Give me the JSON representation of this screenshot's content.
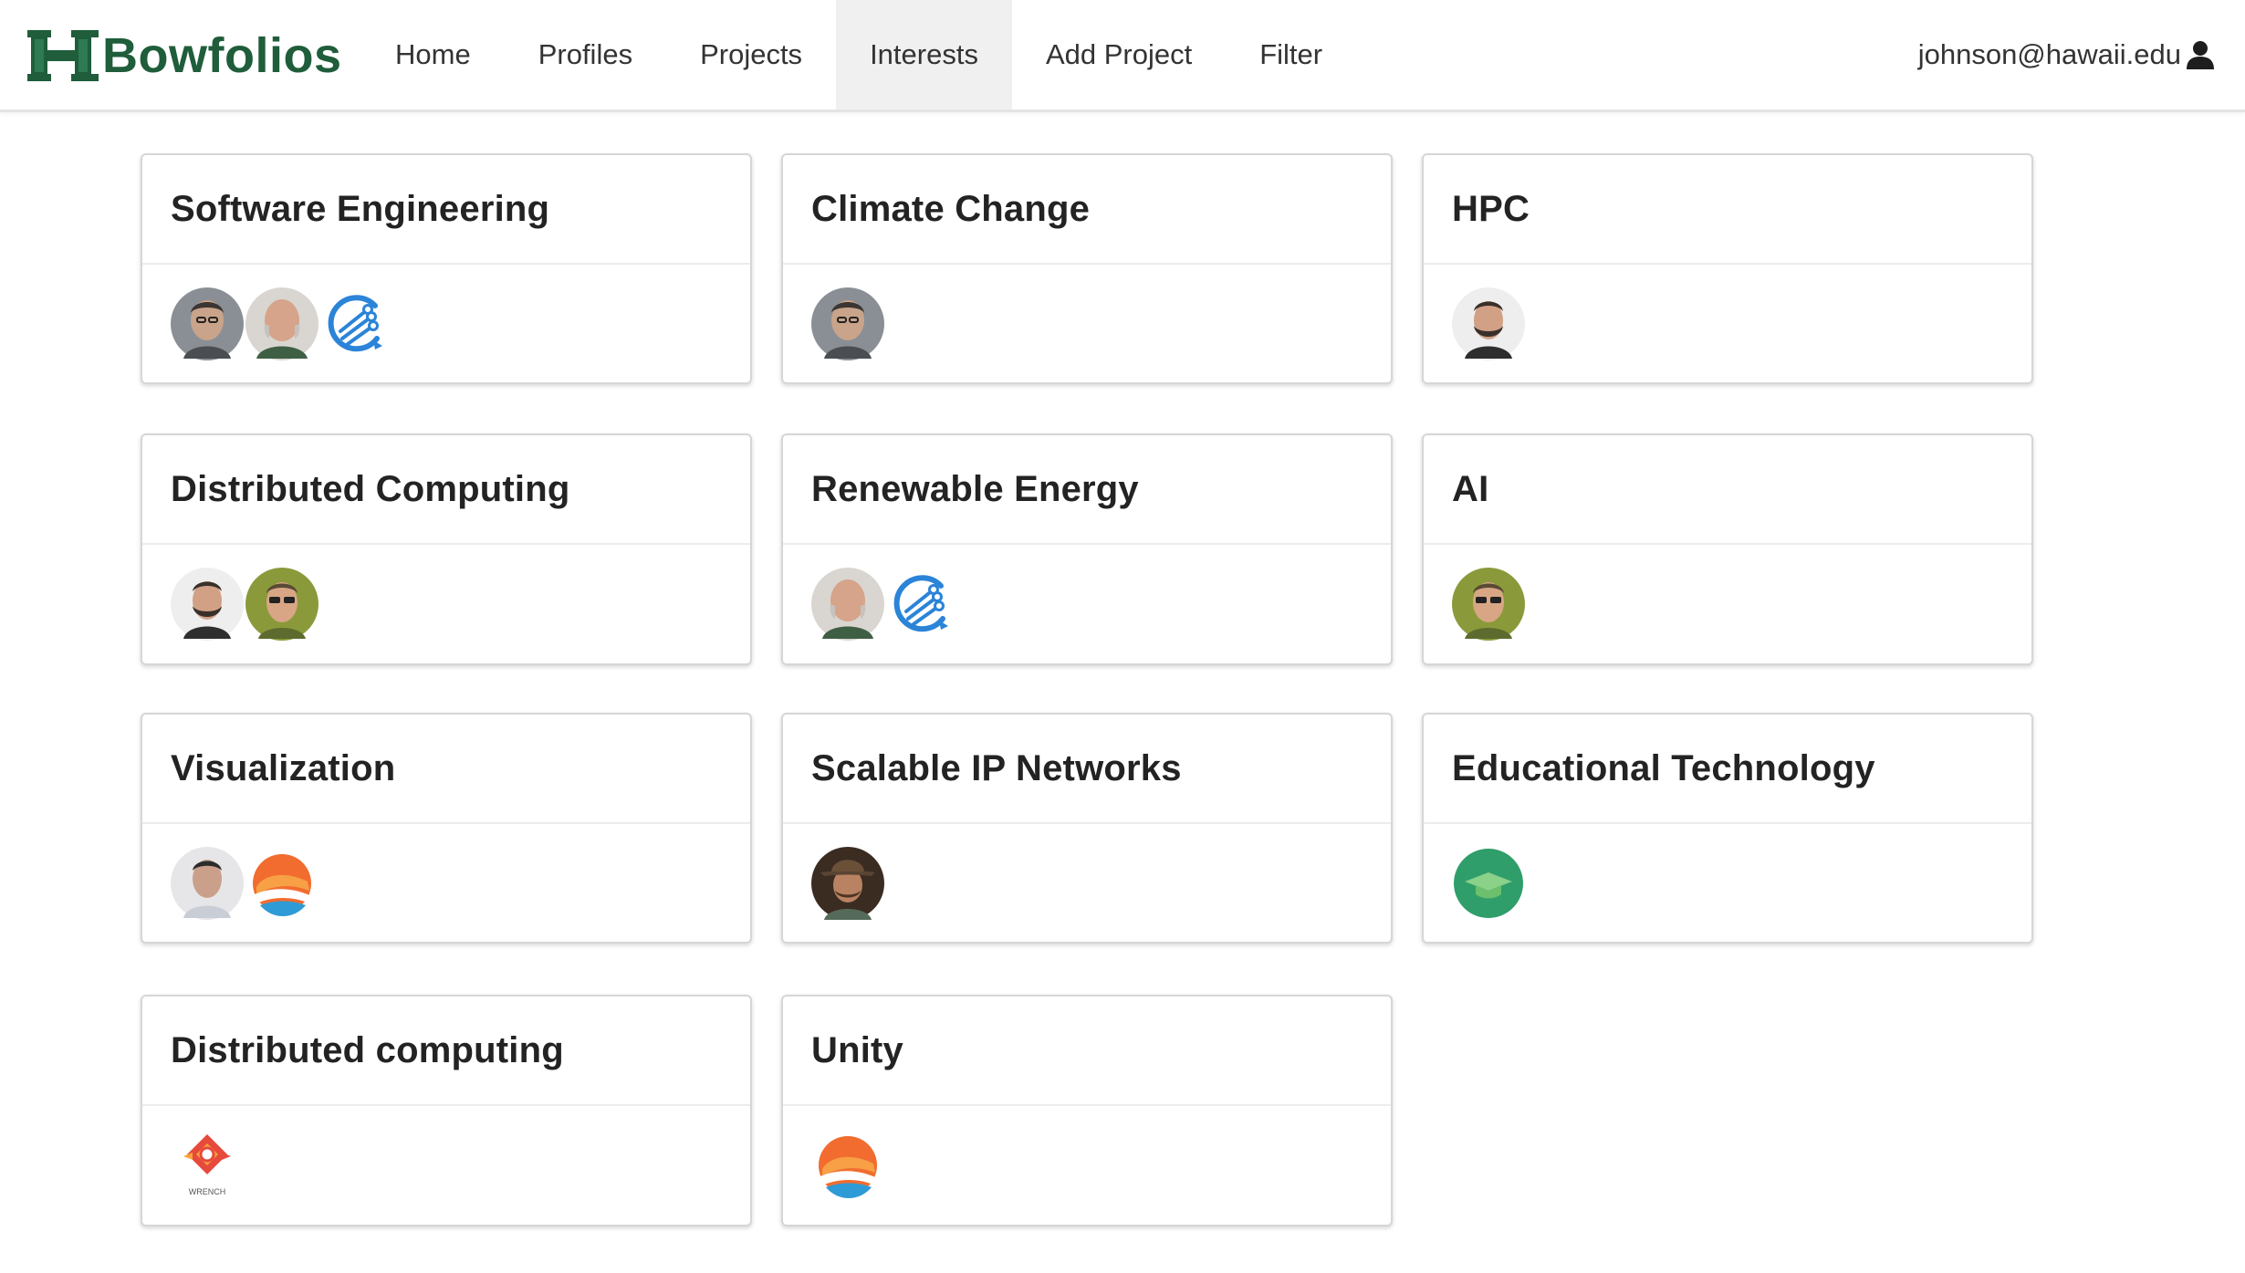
{
  "brand": {
    "name": "Bowfolios",
    "color": "#1f5d3b"
  },
  "nav": {
    "items": [
      "Home",
      "Profiles",
      "Projects",
      "Interests",
      "Add Project",
      "Filter"
    ],
    "active": "Interests",
    "user": "johnson@hawaii.edu"
  },
  "interests": [
    {
      "name": "Software Engineering",
      "members": [
        "person-icon",
        "person-icon",
        "project-logo-icon"
      ]
    },
    {
      "name": "Climate Change",
      "members": [
        "person-icon"
      ]
    },
    {
      "name": "HPC",
      "members": [
        "person-icon"
      ]
    },
    {
      "name": "Distributed Computing",
      "members": [
        "person-icon",
        "person-icon"
      ]
    },
    {
      "name": "Renewable Energy",
      "members": [
        "person-icon",
        "project-logo-icon"
      ]
    },
    {
      "name": "AI",
      "members": [
        "person-icon"
      ]
    },
    {
      "name": "Visualization",
      "members": [
        "person-icon",
        "project-logo-icon"
      ]
    },
    {
      "name": "Scalable IP Networks",
      "members": [
        "person-icon"
      ]
    },
    {
      "name": "Educational Technology",
      "members": [
        "project-logo-icon"
      ]
    },
    {
      "name": "Distributed computing",
      "members": [
        "project-logo-icon"
      ],
      "logo_text": "WRENCH"
    },
    {
      "name": "Unity",
      "members": [
        "project-logo-icon"
      ]
    }
  ]
}
